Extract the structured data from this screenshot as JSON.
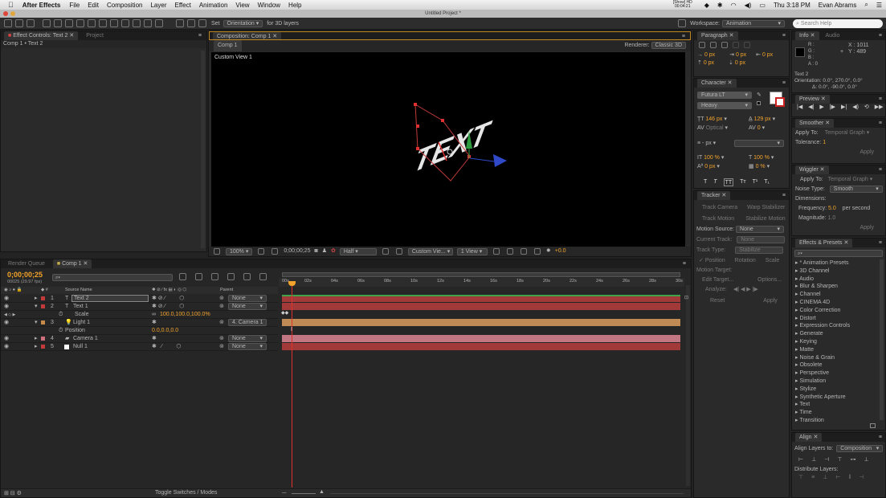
{
  "menubar": {
    "app": "After Effects",
    "items": [
      "File",
      "Edit",
      "Composition",
      "Layer",
      "Effect",
      "Animation",
      "View",
      "Window",
      "Help"
    ],
    "status": {
      "show": "[Show] HD",
      "timer": "00:04:21",
      "clock": "Thu 3:18 PM",
      "user": "Evan Abrams"
    }
  },
  "window": {
    "title": "Untitled Project *"
  },
  "toolbar": {
    "set_label": "Set",
    "orientation": "Orientation",
    "for3d": "for 3D layers",
    "workspace_label": "Workspace:",
    "workspace_value": "Animation",
    "search_placeholder": "Search Help"
  },
  "effect_controls": {
    "tab": "Effect Controls: Text 2",
    "tab2": "Project",
    "breadcrumb": "Comp 1 • Text 2"
  },
  "composition": {
    "tab": "Composition: Comp 1",
    "comp_tab": "Comp 1",
    "renderer_label": "Renderer:",
    "renderer_value": "Classic 3D",
    "view_label": "Custom View 1",
    "viewport_text": "TEXT",
    "bottom": {
      "zoom": "100%",
      "timecode": "0;00;00;25",
      "resolution": "Half",
      "view": "Custom Vie...",
      "views": "1 View",
      "exposure": "+0.0"
    }
  },
  "paragraph": {
    "tab": "Paragraph",
    "fields": [
      "0 px",
      "0 px",
      "0 px",
      "0 px",
      "0 px"
    ]
  },
  "character": {
    "tab": "Character",
    "font": "Futura LT",
    "style": "Heavy",
    "size": "146 px",
    "leading": "129 px",
    "kerning": "Optical",
    "tracking": "0",
    "stroke": "- px",
    "vscale": "100 %",
    "hscale": "100 %",
    "baseline": "0 px",
    "tsume": "0 %",
    "styles": [
      "T",
      "T",
      "TT",
      "Tт",
      "T¹",
      "T₁"
    ]
  },
  "tracker": {
    "tab": "Tracker",
    "track_camera": "Track Camera",
    "warp": "Warp Stabilizer",
    "track_motion": "Track Motion",
    "stabilize": "Stabilize Motion",
    "motion_source_label": "Motion Source:",
    "motion_source": "None",
    "current_track_label": "Current Track:",
    "current_track": "None",
    "track_type_label": "Track Type:",
    "track_type": "Stabilize",
    "position": "Position",
    "rotation": "Rotation",
    "scale": "Scale",
    "motion_target_label": "Motion Target:",
    "edit_target": "Edit Target...",
    "options": "Options...",
    "analyze_label": "Analyze:",
    "reset": "Reset",
    "apply": "Apply"
  },
  "info": {
    "tab": "Info",
    "tab2": "Audio",
    "r": "R :",
    "g": "G :",
    "b": "B :",
    "a": "A : 0",
    "x": "X : 1011",
    "y": "Y : 489",
    "layer": "Text 2",
    "orientation": "Orientation: 0.0°, 270.0°, 0.0°",
    "delta": "Δ: 0.0°, -90.0°, 0.0°"
  },
  "preview": {
    "tab": "Preview"
  },
  "smoother": {
    "tab": "Smoother",
    "apply_to_label": "Apply To:",
    "apply_to": "Temporal Graph",
    "tolerance_label": "Tolerance:",
    "tolerance": "1",
    "apply": "Apply"
  },
  "wiggler": {
    "tab": "Wiggler",
    "apply_to_label": "Apply To:",
    "apply_to": "Temporal Graph",
    "noise_label": "Noise Type:",
    "noise": "Smooth",
    "dimensions": "Dimensions:",
    "freq_label": "Frequency:",
    "freq": "5.0",
    "freq_unit": "per second",
    "mag_label": "Magnitude:",
    "mag": "1.0",
    "apply": "Apply"
  },
  "effects_presets": {
    "tab": "Effects & Presets",
    "items": [
      "* Animation Presets",
      "3D Channel",
      "Audio",
      "Blur & Sharpen",
      "Channel",
      "CINEMA 4D",
      "Color Correction",
      "Distort",
      "Expression Controls",
      "Generate",
      "Keying",
      "Matte",
      "Noise & Grain",
      "Obsolete",
      "Perspective",
      "Simulation",
      "Stylize",
      "Synthetic Aperture",
      "Text",
      "Time",
      "Transition"
    ]
  },
  "align": {
    "tab": "Align",
    "align_to_label": "Align Layers to:",
    "align_to": "Composition",
    "distribute": "Distribute Layers:"
  },
  "timeline": {
    "tab1": "Render Queue",
    "tab2": "Comp 1",
    "timecode": "0;00;00;25",
    "fps": "00025 (29.97 fps)",
    "col_source": "Source Name",
    "col_parent": "Parent",
    "layers": [
      {
        "num": "1",
        "name": "Text 2",
        "parent": "None",
        "color": "#c23a3a"
      },
      {
        "num": "2",
        "name": "Text 1",
        "parent": "None",
        "color": "#c23a3a"
      },
      {
        "num": "3",
        "name": "Light 1",
        "parent": "4. Camera 1",
        "color": "#c88c4a"
      },
      {
        "num": "4",
        "name": "Camera 1",
        "parent": "None",
        "color": "#d06f7e"
      },
      {
        "num": "5",
        "name": "Null 1",
        "parent": "None",
        "color": "#c23a3a"
      }
    ],
    "scale_label": "Scale",
    "scale_value": "100.0,100.0,100.0%",
    "position_label": "Position",
    "position_value": "0.0,0.0,0.0",
    "ruler": [
      "00s",
      "02s",
      "04s",
      "06s",
      "08s",
      "10s",
      "12s",
      "14s",
      "16s",
      "18s",
      "20s",
      "22s",
      "24s",
      "26s",
      "28s",
      "30s"
    ],
    "toggle": "Toggle Switches / Modes"
  }
}
